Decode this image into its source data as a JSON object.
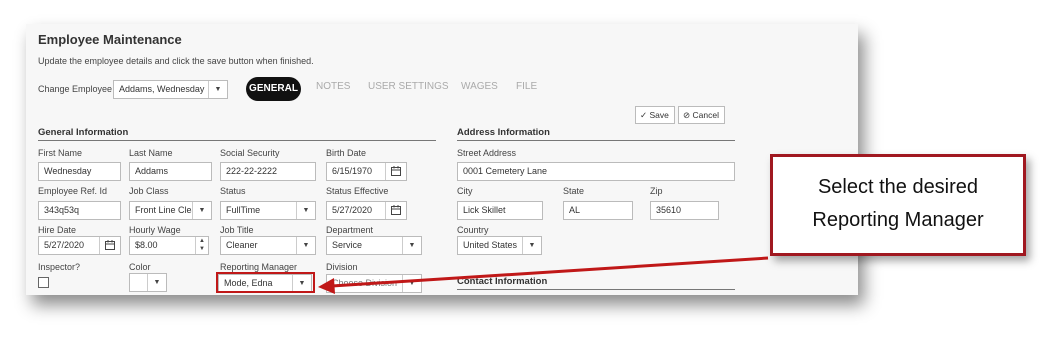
{
  "header": {
    "title": "Employee Maintenance",
    "subtitle": "Update the employee details and click the save button when finished."
  },
  "employee_picker": {
    "label": "Change Employee",
    "value": "Addams, Wednesday"
  },
  "tabs": [
    {
      "label": "GENERAL",
      "active": true
    },
    {
      "label": "NOTES"
    },
    {
      "label": "USER SETTINGS"
    },
    {
      "label": "WAGES"
    },
    {
      "label": "FILE"
    }
  ],
  "buttons": {
    "save": "Save",
    "cancel": "Cancel"
  },
  "general": {
    "heading": "General Information",
    "first_name": {
      "label": "First Name",
      "value": "Wednesday"
    },
    "last_name": {
      "label": "Last Name",
      "value": "Addams"
    },
    "ssn": {
      "label": "Social Security",
      "value": "222-22-2222"
    },
    "birth_date": {
      "label": "Birth Date",
      "value": "6/15/1970"
    },
    "ref_id": {
      "label": "Employee Ref. Id",
      "value": "343q53q"
    },
    "job_class": {
      "label": "Job Class",
      "value": "Front Line Clear"
    },
    "status": {
      "label": "Status",
      "value": "FullTime"
    },
    "status_effective": {
      "label": "Status Effective",
      "value": "5/27/2020"
    },
    "hire_date": {
      "label": "Hire Date",
      "value": "5/27/2020"
    },
    "hourly_wage": {
      "label": "Hourly Wage",
      "value": "$8.00"
    },
    "job_title": {
      "label": "Job Title",
      "value": "Cleaner"
    },
    "department": {
      "label": "Department",
      "value": "Service"
    },
    "inspector": {
      "label": "Inspector?"
    },
    "color": {
      "label": "Color"
    },
    "reporting_manager": {
      "label": "Reporting Manager",
      "value": "Mode, Edna"
    },
    "division": {
      "label": "Division",
      "value": "Choose Division"
    }
  },
  "address": {
    "heading": "Address Information",
    "street": {
      "label": "Street Address",
      "value": "0001 Cemetery Lane"
    },
    "city": {
      "label": "City",
      "value": "Lick Skillet"
    },
    "state": {
      "label": "State",
      "value": "AL"
    },
    "zip": {
      "label": "Zip",
      "value": "35610"
    },
    "country": {
      "label": "Country",
      "value": "United States"
    }
  },
  "contact": {
    "heading": "Contact Information"
  },
  "callout": {
    "line1": "Select the desired",
    "line2": "Reporting Manager"
  },
  "colors": {
    "callout_border": "#a01820",
    "arrow": "#c01818",
    "tab_active_bg": "#111111"
  }
}
